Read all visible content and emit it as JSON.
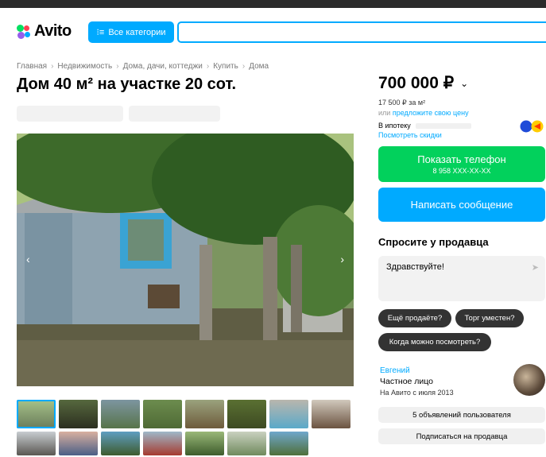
{
  "header": {
    "logo_text": "Avito",
    "categories_label": "Все категории",
    "search_placeholder": ""
  },
  "breadcrumb": [
    "Главная",
    "Недвижимость",
    "Дома, дачи, коттеджи",
    "Купить",
    "Дома"
  ],
  "listing": {
    "title": "Дом 40 м² на участке 20 сот.",
    "price": "700 000 ₽",
    "price_per_m": "17 500 ₽ за м²",
    "offer_prefix": "или",
    "offer_link": "предложите свою цену",
    "mortgage_label": "В ипотеку",
    "discounts_link": "Посмотреть скидки"
  },
  "contact": {
    "phone_button": "Показать телефон",
    "phone_masked": "8 958 XXX-XX-XX",
    "message_button": "Написать сообщение"
  },
  "ask_seller": {
    "heading": "Спросите у продавца",
    "message_text": "Здравствуйте!",
    "chips": [
      "Ещё продаёте?",
      "Торг уместен?",
      "Когда можно посмотреть?"
    ]
  },
  "seller": {
    "name": "Евгений",
    "type": "Частное лицо",
    "since": "На Авито с июля 2013",
    "ads_button": "5 объявлений пользователя",
    "subscribe_button": "Подписаться на продавца"
  },
  "colors": {
    "accent_blue": "#00aaff",
    "phone_green": "#02d15c",
    "chip_dark": "#333333"
  },
  "icons": {
    "search": "search-icon",
    "expand_price": "chevron-down-icon",
    "send": "send-icon",
    "prev": "chevron-left-icon",
    "next": "chevron-right-icon"
  }
}
